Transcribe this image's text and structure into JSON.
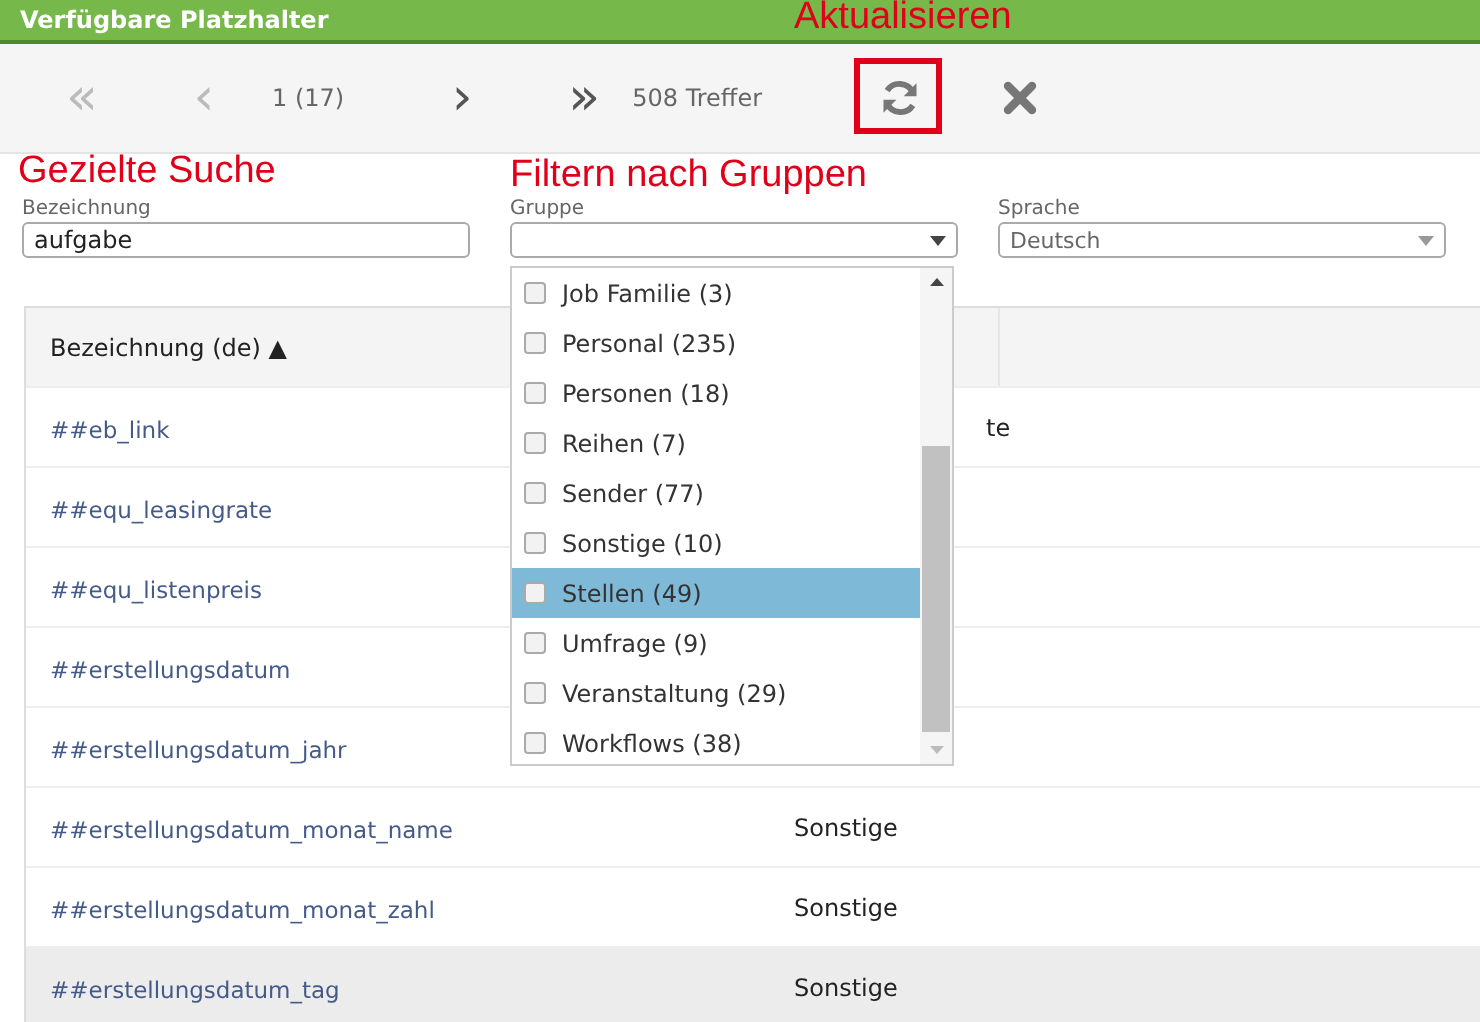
{
  "window": {
    "title": "Verfügbare Platzhalter"
  },
  "toolbar": {
    "first": "«",
    "prev": "‹",
    "page": "1 (17)",
    "next": "›",
    "last": "»",
    "hits": "508 Treffer"
  },
  "filters": [
    {
      "label": "Bezeichnung",
      "value": "aufgabe",
      "kind": "text"
    },
    {
      "label": "Gruppe",
      "kind": "select",
      "disabled": false
    },
    {
      "label": "Sprache",
      "value": "Deutsch",
      "kind": "select",
      "disabled": true
    }
  ],
  "table": {
    "columns": [
      "Bezeichnung (de) ▲"
    ],
    "rows": [
      {
        "name": "##eb_link",
        "group": "te",
        "highlighted": false
      },
      {
        "name": "##equ_leasingrate",
        "highlighted": false
      },
      {
        "name": "##equ_listenpreis",
        "highlighted": false
      },
      {
        "name": "##erstellungsdatum",
        "highlighted": false
      },
      {
        "name": "##erstellungsdatum_jahr",
        "highlighted": false
      },
      {
        "name": "##erstellungsdatum_monat_name",
        "group": "Sonstige",
        "highlighted": false
      },
      {
        "name": "##erstellungsdatum_monat_zahl",
        "group": "Sonstige",
        "highlighted": false
      },
      {
        "name": "##erstellungsdatum_tag",
        "group": "Sonstige",
        "highlighted": true
      }
    ]
  },
  "dropdown": {
    "items": [
      {
        "label": "Job Familie (3)",
        "checked": false,
        "selected": false
      },
      {
        "label": "Personal (235)",
        "checked": false,
        "selected": false
      },
      {
        "label": "Personen (18)",
        "checked": false,
        "selected": false
      },
      {
        "label": "Reihen (7)",
        "checked": false,
        "selected": false
      },
      {
        "label": "Sender (77)",
        "checked": false,
        "selected": false
      },
      {
        "label": "Sonstige (10)",
        "checked": false,
        "selected": false
      },
      {
        "label": "Stellen (49)",
        "checked": false,
        "selected": true
      },
      {
        "label": "Umfrage (9)",
        "checked": false,
        "selected": false
      },
      {
        "label": "Veranstaltung (29)",
        "checked": false,
        "selected": false
      },
      {
        "label": "Workflows (38)",
        "checked": false,
        "selected": false
      }
    ]
  },
  "annotations": {
    "refresh": "Aktualisieren",
    "search": "Gezielte Suche",
    "group": "Filtern nach Gruppen"
  }
}
